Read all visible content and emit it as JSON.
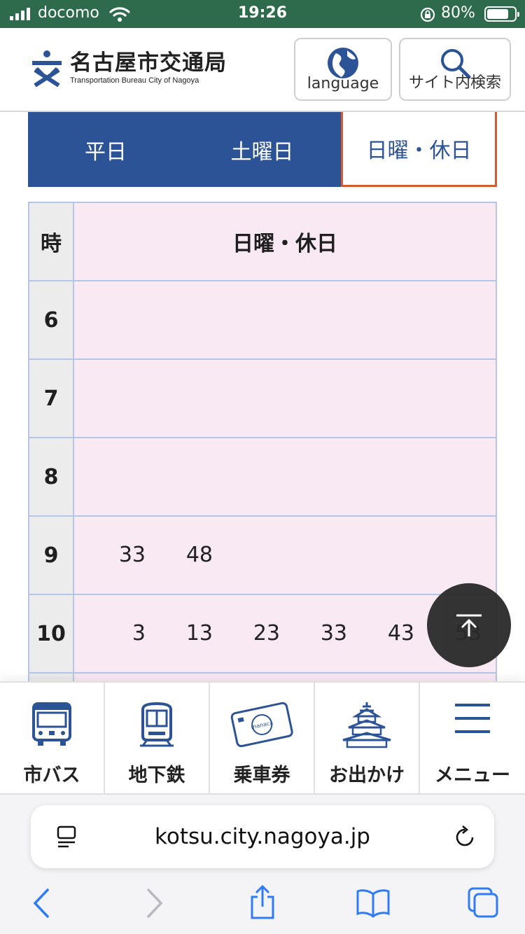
{
  "status": {
    "carrier": "docomo",
    "time": "19:26",
    "battery": "80%"
  },
  "header": {
    "logo_ja": "名古屋市交通局",
    "logo_en": "Transportation Bureau City of Nagoya",
    "language_label": "language",
    "search_label": "サイト内検索"
  },
  "tabs": [
    {
      "label": "平日"
    },
    {
      "label": "土曜日"
    },
    {
      "label": "日曜・休日"
    }
  ],
  "timetable": {
    "hour_header": "時",
    "column_header": "日曜・休日",
    "rows": [
      {
        "hour": "6",
        "minutes": []
      },
      {
        "hour": "7",
        "minutes": []
      },
      {
        "hour": "8",
        "minutes": []
      },
      {
        "hour": "9",
        "minutes": [
          "33",
          "48"
        ]
      },
      {
        "hour": "10",
        "minutes": [
          "3",
          "13",
          "23",
          "33",
          "43",
          "53"
        ]
      }
    ]
  },
  "bottom_nav": [
    {
      "label": "市バス",
      "icon": "bus-icon"
    },
    {
      "label": "地下鉄",
      "icon": "subway-icon"
    },
    {
      "label": "乗車券",
      "icon": "manaca-card-icon",
      "card_text": "manaca"
    },
    {
      "label": "お出かけ",
      "icon": "castle-icon"
    },
    {
      "label": "メニュー",
      "icon": "hamburger-menu-icon"
    }
  ],
  "browser": {
    "url": "kotsu.city.nagoya.jp"
  },
  "colors": {
    "brand_blue": "#2d5397",
    "active_tab_border": "#d35a32",
    "cell_pink": "#f8e9f3",
    "status_green": "#2e6b4c"
  }
}
